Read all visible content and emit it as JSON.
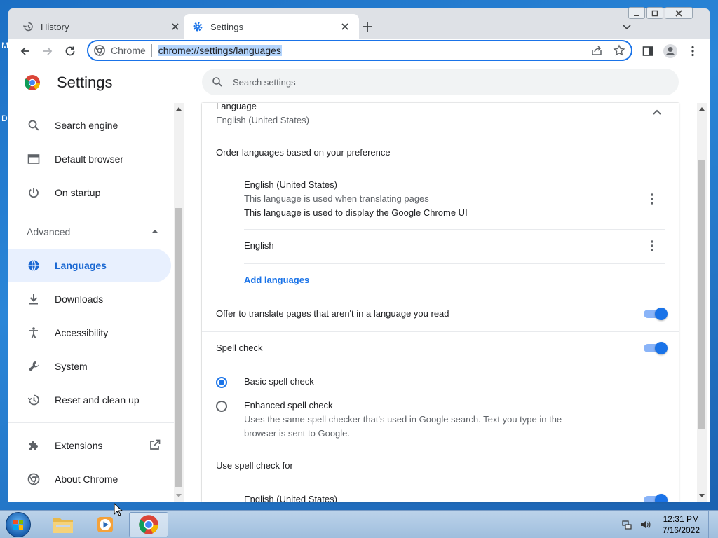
{
  "browser": {
    "tabs": [
      {
        "title": "History",
        "icon": "history-icon",
        "active": false
      },
      {
        "title": "Settings",
        "icon": "gear-icon",
        "active": true
      }
    ],
    "omnibox": {
      "chip": "Chrome",
      "url": "chrome://settings/languages"
    }
  },
  "settings": {
    "title": "Settings",
    "search_placeholder": "Search settings",
    "sidebar": {
      "items_top": [
        {
          "label": "Search engine",
          "icon": "search-icon"
        },
        {
          "label": "Default browser",
          "icon": "browser-icon"
        },
        {
          "label": "On startup",
          "icon": "power-icon"
        }
      ],
      "advanced_label": "Advanced",
      "items_advanced": [
        {
          "label": "Languages",
          "icon": "globe-icon",
          "selected": true
        },
        {
          "label": "Downloads",
          "icon": "download-icon"
        },
        {
          "label": "Accessibility",
          "icon": "accessibility-icon"
        },
        {
          "label": "System",
          "icon": "wrench-icon"
        },
        {
          "label": "Reset and clean up",
          "icon": "reset-icon"
        }
      ],
      "extensions": "Extensions",
      "about": "About Chrome"
    },
    "languages": {
      "section_title": "Language",
      "section_value": "English (United States)",
      "order_label": "Order languages based on your preference",
      "list": [
        {
          "name": "English (United States)",
          "note1": "This language is used when translating pages",
          "note2": "This language is used to display the Google Chrome UI"
        },
        {
          "name": "English"
        }
      ],
      "add_languages": "Add languages",
      "offer_translate": "Offer to translate pages that aren't in a language you read",
      "offer_translate_on": true,
      "spell_check": "Spell check",
      "spell_check_on": true,
      "basic_spell": "Basic spell check",
      "enhanced_spell": "Enhanced spell check",
      "enhanced_desc1": "Uses the same spell checker that's used in Google search. Text you type in the",
      "enhanced_desc2": "browser is sent to Google.",
      "selected_spell": "basic",
      "use_spell_for": "Use spell check for",
      "spell_lang": "English (United States)"
    }
  },
  "taskbar": {
    "time": "12:31 PM",
    "date": "7/16/2022"
  },
  "colors": {
    "accent": "#1a73e8",
    "selected_bg": "#e8f0fe"
  }
}
